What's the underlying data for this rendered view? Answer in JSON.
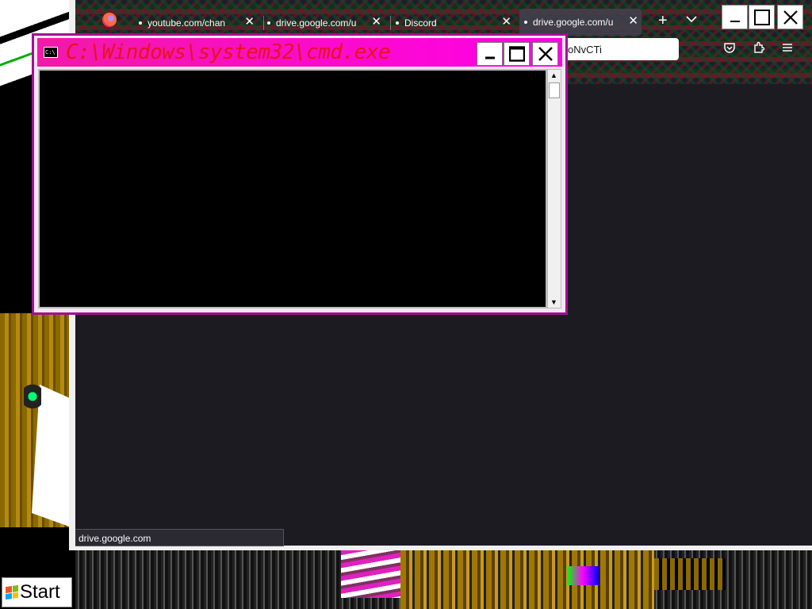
{
  "browser": {
    "tabs": [
      {
        "label": "youtube.com/chan",
        "active": false
      },
      {
        "label": "drive.google.com/u",
        "active": false
      },
      {
        "label": "Discord",
        "active": false
      },
      {
        "label": "drive.google.com/u",
        "active": true
      }
    ],
    "url_fragment": "oNvCTi",
    "status_url": "drive.google.com",
    "icons": {
      "new_tab": "+",
      "list_tabs": "⌵",
      "pocket": "pocket-icon",
      "extensions": "puzzle-icon",
      "menu": "hamburger-icon",
      "close_tab": "✕"
    }
  },
  "cmd": {
    "title": "C:\\Windows\\system32\\cmd.exe",
    "icon_text": "C:\\",
    "title_color": "#e8131b",
    "titlebar_color": "#ff00e8"
  },
  "taskbar": {
    "start_label": "Start"
  }
}
